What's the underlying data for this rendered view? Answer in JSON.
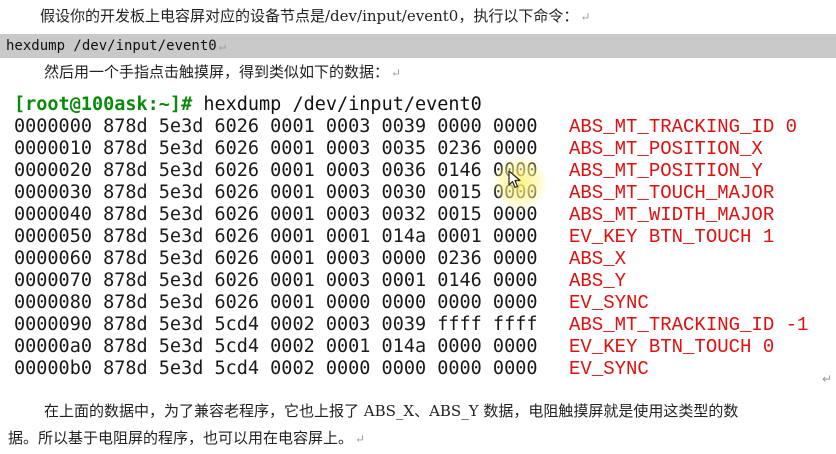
{
  "intro": {
    "text": "假设你的开发板上电容屏对应的设备节点是/dev/input/event0，执行以下命令：",
    "mark": "↵"
  },
  "command": {
    "text": "hexdump /dev/input/event0",
    "mark": "↵"
  },
  "instruction": {
    "text": "然后用一个手指点击触摸屏，得到类似如下的数据：",
    "mark": "↵"
  },
  "terminal": {
    "prompt": "[root@100ask:~]#",
    "command": "hexdump /dev/input/event0",
    "rows": [
      {
        "hex": "0000000 878d 5e3d 6026 0001 0003 0039 0000 0000",
        "label": "ABS_MT_TRACKING_ID 0"
      },
      {
        "hex": "0000010 878d 5e3d 6026 0001 0003 0035 0236 0000",
        "label": "ABS_MT_POSITION_X"
      },
      {
        "hex": "0000020 878d 5e3d 6026 0001 0003 0036 0146 0000",
        "label": "ABS_MT_POSITION_Y"
      },
      {
        "hex": "0000030 878d 5e3d 6026 0001 0003 0030 0015 0000",
        "label": "ABS_MT_TOUCH_MAJOR"
      },
      {
        "hex": "0000040 878d 5e3d 6026 0001 0003 0032 0015 0000",
        "label": "ABS_MT_WIDTH_MAJOR"
      },
      {
        "hex": "0000050 878d 5e3d 6026 0001 0001 014a 0001 0000",
        "label": "EV_KEY BTN_TOUCH 1"
      },
      {
        "hex": "0000060 878d 5e3d 6026 0001 0003 0000 0236 0000",
        "label": "ABS_X"
      },
      {
        "hex": "0000070 878d 5e3d 6026 0001 0003 0001 0146 0000",
        "label": "ABS_Y"
      },
      {
        "hex": "0000080 878d 5e3d 6026 0001 0000 0000 0000 0000",
        "label": "EV_SYNC"
      },
      {
        "hex": "0000090 878d 5e3d 5cd4 0002 0003 0039 ffff ffff",
        "label": "ABS_MT_TRACKING_ID -1"
      },
      {
        "hex": "00000a0 878d 5e3d 5cd4 0002 0001 014a 0000 0000",
        "label": "EV_KEY BTN_TOUCH 0"
      },
      {
        "hex": "00000b0 878d 5e3d 5cd4 0002 0000 0000 0000 0000",
        "label": "EV_SYNC"
      }
    ],
    "end_mark": "↵"
  },
  "explanation": {
    "line1": "在上面的数据中，为了兼容老程序，它也上报了 ABS_X、ABS_Y 数据，电阻触摸屏就是使用这类型的数",
    "line2": "据。所以基于电阻屏的程序，也可以用在电容屏上。",
    "mark": "↵"
  },
  "colors": {
    "prompt": "#0a8a0a",
    "event_label": "#e01010",
    "command_bar": "#c9c9c9",
    "cursor_highlight": "#fff06e"
  },
  "icons": {
    "cursor": "mouse-pointer-icon"
  }
}
